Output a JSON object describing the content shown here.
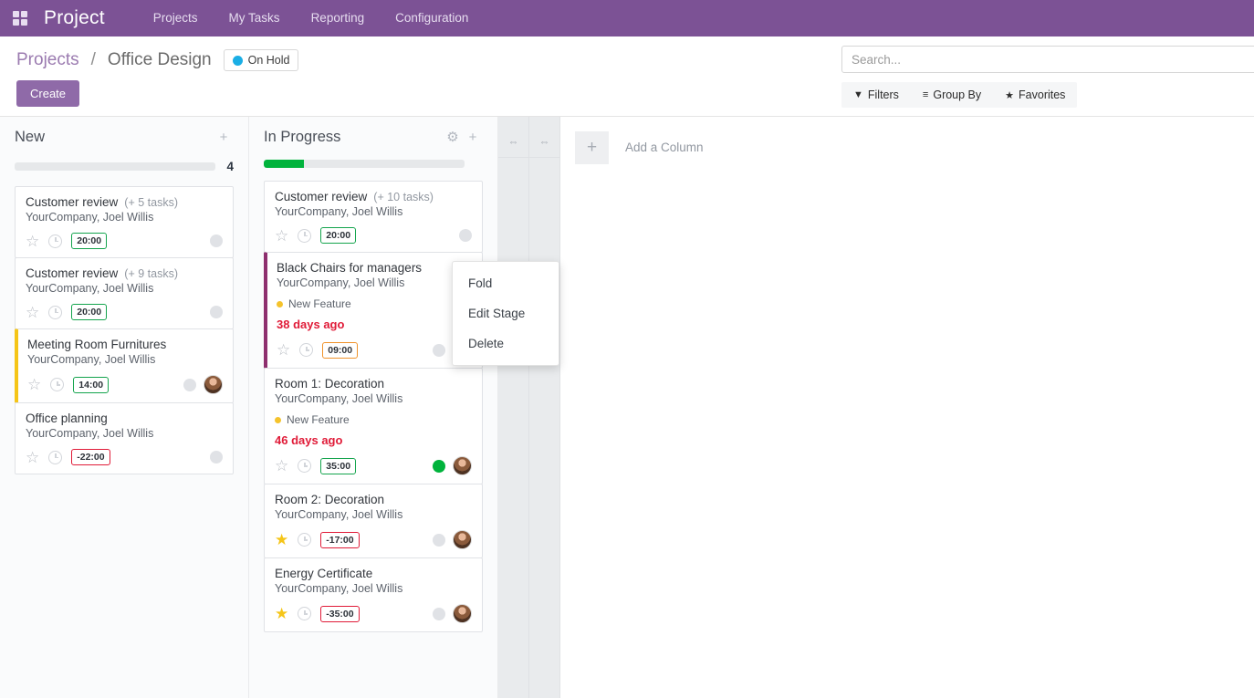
{
  "navbar": {
    "apps_icon": "apps-grid-icon",
    "brand": "Project",
    "items": [
      {
        "label": "Projects"
      },
      {
        "label": "My Tasks"
      },
      {
        "label": "Reporting"
      },
      {
        "label": "Configuration"
      }
    ]
  },
  "control_panel": {
    "breadcrumb": {
      "root": "Projects",
      "separator": "/",
      "current": "Office Design"
    },
    "status_badge": {
      "label": "On Hold",
      "dot_color": "#1aaee5"
    },
    "create_label": "Create",
    "search": {
      "placeholder": "Search...",
      "value": ""
    },
    "filters": [
      {
        "icon": "filter-icon",
        "glyph": "▼",
        "label": "Filters"
      },
      {
        "icon": "group-by-icon",
        "glyph": "≡",
        "label": "Group By"
      },
      {
        "icon": "star-icon",
        "glyph": "★",
        "label": "Favorites"
      }
    ]
  },
  "board": {
    "columns": [
      {
        "title": "New",
        "count": "4",
        "progress_percent": 0,
        "progress_color": "#00b33c",
        "has_gear": false,
        "cards": [
          {
            "title": "Customer review",
            "subtitle": "(+ 5 tasks)",
            "company": "YourCompany, Joel Willis",
            "tag": null,
            "date": null,
            "starred": false,
            "time": "20:00",
            "time_state": "ok",
            "state_dot": "gray",
            "avatar": false,
            "border_color": null
          },
          {
            "title": "Customer review",
            "subtitle": "(+ 9 tasks)",
            "company": "YourCompany, Joel Willis",
            "tag": null,
            "date": null,
            "starred": false,
            "time": "20:00",
            "time_state": "ok",
            "state_dot": "gray",
            "avatar": false,
            "border_color": null
          },
          {
            "title": "Meeting Room Furnitures",
            "subtitle": null,
            "company": "YourCompany, Joel Willis",
            "tag": null,
            "date": null,
            "starred": false,
            "time": "14:00",
            "time_state": "ok",
            "state_dot": "gray",
            "avatar": true,
            "border_color": "#f5c518"
          },
          {
            "title": "Office planning",
            "subtitle": null,
            "company": "YourCompany, Joel Willis",
            "tag": null,
            "date": null,
            "starred": false,
            "time": "-22:00",
            "time_state": "danger",
            "state_dot": "gray",
            "avatar": false,
            "border_color": null
          }
        ]
      },
      {
        "title": "In Progress",
        "count": "",
        "progress_percent": 20,
        "progress_color": "#00b33c",
        "has_gear": true,
        "cards": [
          {
            "title": "Customer review",
            "subtitle": "(+ 10 tasks)",
            "company": "YourCompany, Joel Willis",
            "tag": null,
            "date": null,
            "starred": false,
            "time": "20:00",
            "time_state": "ok",
            "state_dot": "gray",
            "avatar": false,
            "border_color": null
          },
          {
            "title": "Black Chairs for managers",
            "subtitle": null,
            "company": "YourCompany, Joel Willis",
            "tag": "New Feature",
            "date": "38 days ago",
            "starred": false,
            "time": "09:00",
            "time_state": "warn",
            "state_dot": "gray",
            "avatar": true,
            "border_color": "#8e2f6e"
          },
          {
            "title": "Room 1: Decoration",
            "subtitle": null,
            "company": "YourCompany, Joel Willis",
            "tag": "New Feature",
            "date": "46 days ago",
            "starred": false,
            "time": "35:00",
            "time_state": "ok",
            "state_dot": "green",
            "avatar": true,
            "border_color": null
          },
          {
            "title": "Room 2: Decoration",
            "subtitle": null,
            "company": "YourCompany, Joel Willis",
            "tag": null,
            "date": null,
            "starred": true,
            "time": "-17:00",
            "time_state": "danger",
            "state_dot": "gray",
            "avatar": true,
            "border_color": null
          },
          {
            "title": "Energy Certificate",
            "subtitle": null,
            "company": "YourCompany, Joel Willis",
            "tag": null,
            "date": null,
            "starred": true,
            "time": "-35:00",
            "time_state": "danger",
            "state_dot": "gray",
            "avatar": true,
            "border_color": null
          }
        ]
      }
    ],
    "folded_columns": [
      {
        "icon": "expand-horizontal-icon",
        "glyph": "⇔"
      },
      {
        "icon": "expand-horizontal-icon",
        "glyph": "⇔"
      }
    ],
    "add_column": {
      "plus": "+",
      "label": "Add a Column"
    }
  },
  "stage_dropdown": {
    "items": [
      {
        "label": "Fold"
      },
      {
        "label": "Edit Stage"
      },
      {
        "label": "Delete"
      }
    ]
  }
}
